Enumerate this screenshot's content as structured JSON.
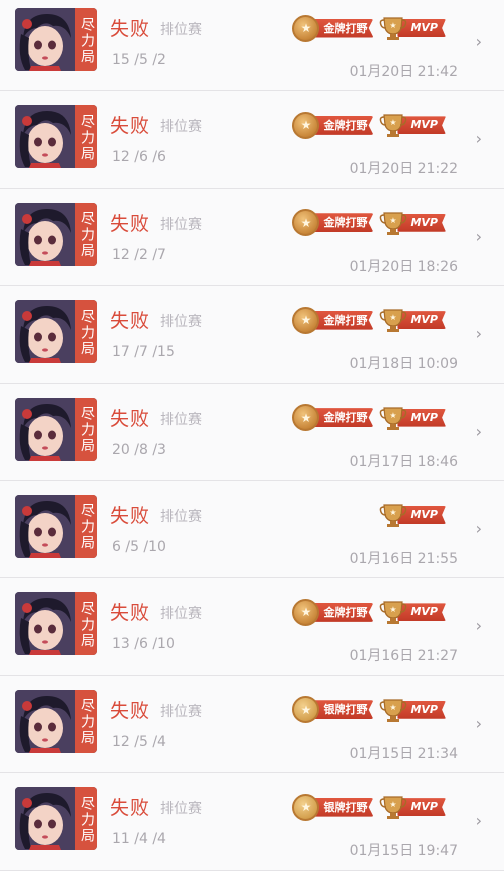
{
  "records": [
    {
      "tag": "尽力局",
      "result": "失败",
      "mode": "排位赛",
      "kda": "15 /5 /2",
      "time": "01月20日 21:42",
      "medal": "金牌打野",
      "medal_tier": "gold",
      "mvp": "MVP"
    },
    {
      "tag": "尽力局",
      "result": "失败",
      "mode": "排位赛",
      "kda": "12 /6 /6",
      "time": "01月20日 21:22",
      "medal": "金牌打野",
      "medal_tier": "gold",
      "mvp": "MVP"
    },
    {
      "tag": "尽力局",
      "result": "失败",
      "mode": "排位赛",
      "kda": "12 /2 /7",
      "time": "01月20日 18:26",
      "medal": "金牌打野",
      "medal_tier": "gold",
      "mvp": "MVP"
    },
    {
      "tag": "尽力局",
      "result": "失败",
      "mode": "排位赛",
      "kda": "17 /7 /15",
      "time": "01月18日 10:09",
      "medal": "金牌打野",
      "medal_tier": "gold",
      "mvp": "MVP"
    },
    {
      "tag": "尽力局",
      "result": "失败",
      "mode": "排位赛",
      "kda": "20 /8 /3",
      "time": "01月17日 18:46",
      "medal": "金牌打野",
      "medal_tier": "gold",
      "mvp": "MVP"
    },
    {
      "tag": "尽力局",
      "result": "失败",
      "mode": "排位赛",
      "kda": "6 /5 /10",
      "time": "01月16日 21:55",
      "medal": "",
      "medal_tier": "none",
      "mvp": "MVP"
    },
    {
      "tag": "尽力局",
      "result": "失败",
      "mode": "排位赛",
      "kda": "13 /6 /10",
      "time": "01月16日 21:27",
      "medal": "金牌打野",
      "medal_tier": "gold",
      "mvp": "MVP"
    },
    {
      "tag": "尽力局",
      "result": "失败",
      "mode": "排位赛",
      "kda": "12 /5 /4",
      "time": "01月15日 21:34",
      "medal": "银牌打野",
      "medal_tier": "silver",
      "mvp": "MVP"
    },
    {
      "tag": "尽力局",
      "result": "失败",
      "mode": "排位赛",
      "kda": "11 /4 /4",
      "time": "01月15日 19:47",
      "medal": "银牌打野",
      "medal_tier": "silver",
      "mvp": "MVP"
    }
  ],
  "icons": {
    "chevron": "chevron-right-icon",
    "medal": "medal-icon",
    "trophy": "trophy-icon",
    "avatar": "hero-avatar"
  },
  "colors": {
    "result": "#d94b3a",
    "tag_bg": "#d6523e",
    "ribbon": "#c23a27",
    "medal": "#c9873a"
  }
}
